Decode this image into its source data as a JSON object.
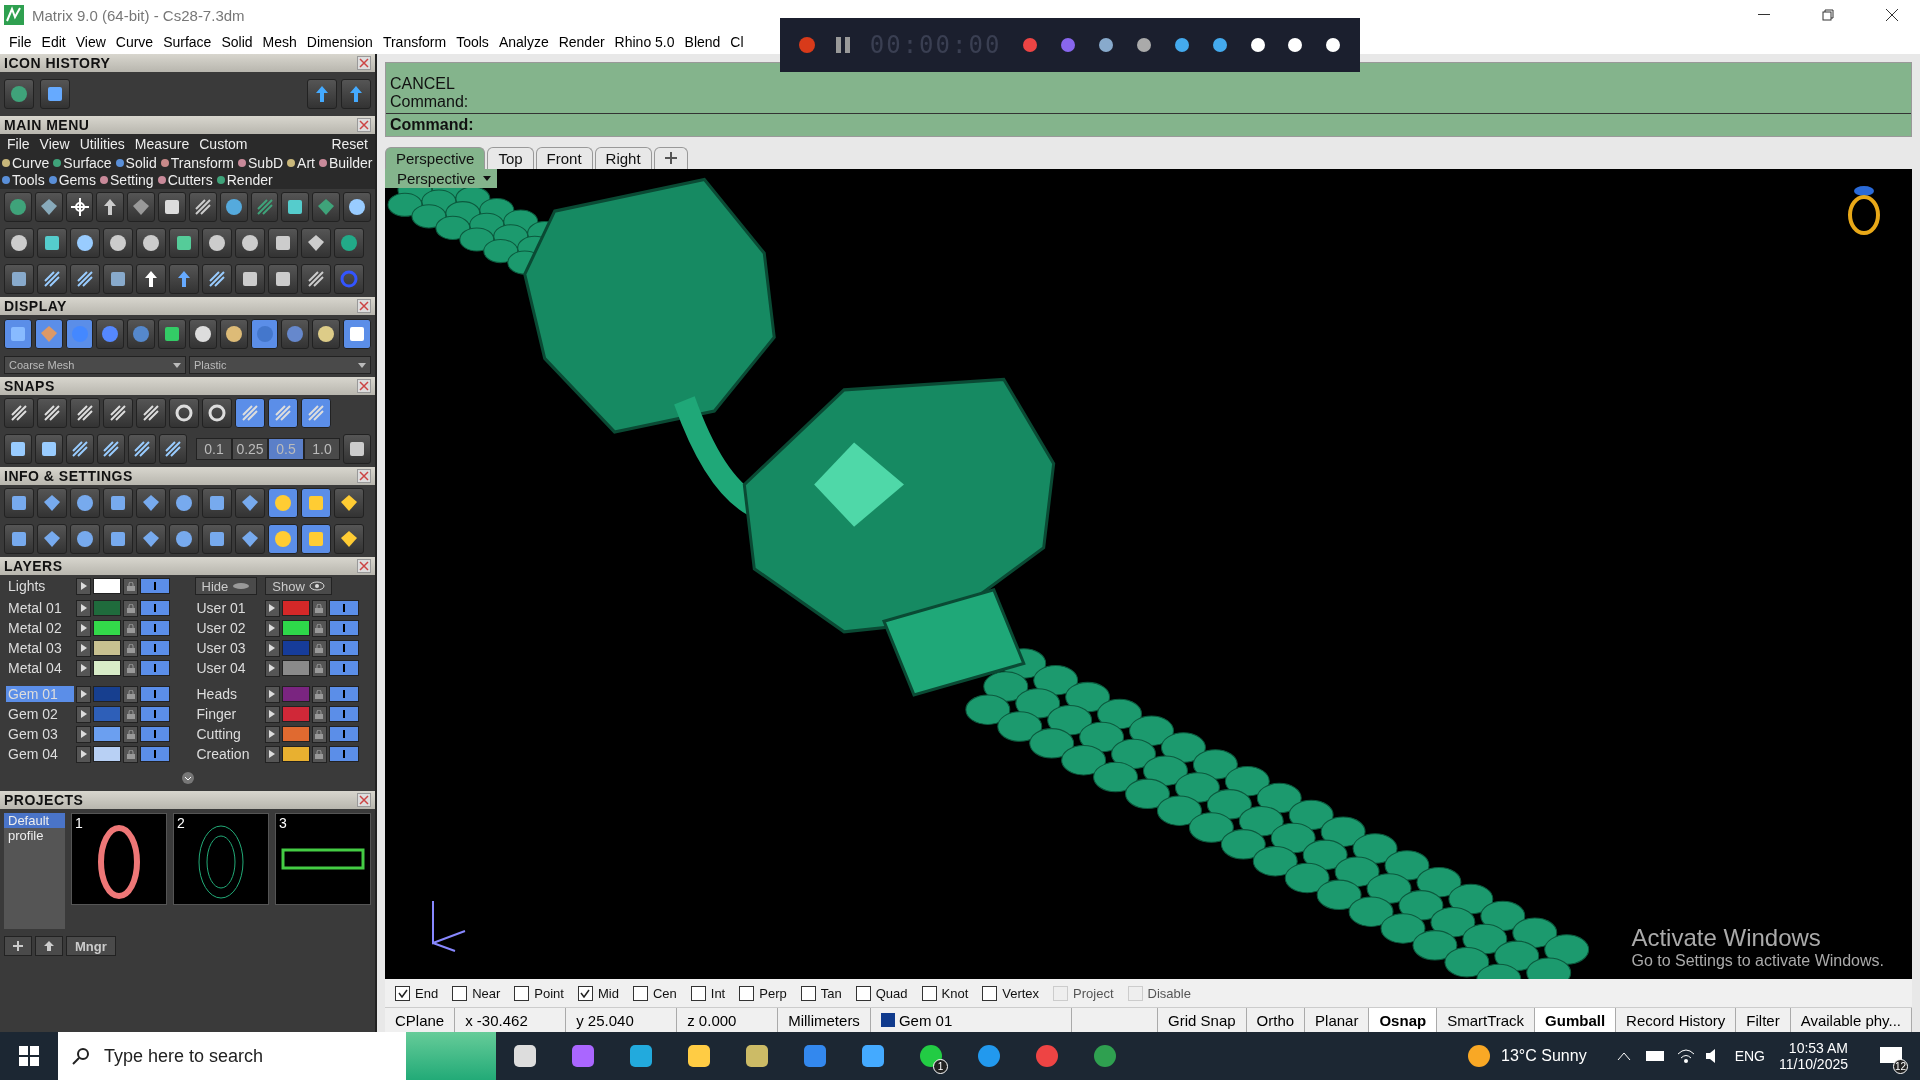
{
  "window": {
    "title": "Matrix 9.0 (64-bit) - Cs28-7.3dm"
  },
  "menu_bar": [
    "File",
    "Edit",
    "View",
    "Curve",
    "Surface",
    "Solid",
    "Mesh",
    "Dimension",
    "Transform",
    "Tools",
    "Analyze",
    "Render",
    "Rhino 5.0",
    "Blend",
    "Cl"
  ],
  "recorder": {
    "timer": "00:00:00"
  },
  "icon_history": {
    "title": "ICON HISTORY"
  },
  "main_menu": {
    "title": "MAIN MENU",
    "menu": [
      "File",
      "View",
      "Utilities",
      "Measure",
      "Custom"
    ],
    "reset": "Reset",
    "categories": [
      {
        "label": "Curve",
        "color": "#c9b77a"
      },
      {
        "label": "Surface",
        "color": "#3fa37a"
      },
      {
        "label": "Solid",
        "color": "#5a8fd8"
      },
      {
        "label": "Transform",
        "color": "#c98a8a"
      },
      {
        "label": "SubD",
        "color": "#c98a9a"
      },
      {
        "label": "Art",
        "color": "#c9b77a"
      },
      {
        "label": "Builder",
        "color": "#c98a9a"
      },
      {
        "label": "Tools",
        "color": "#5a8fd8"
      },
      {
        "label": "Gems",
        "color": "#5a8fd8"
      },
      {
        "label": "Setting",
        "color": "#c98a9a"
      },
      {
        "label": "Cutters",
        "color": "#c98a9a"
      },
      {
        "label": "Render",
        "color": "#3fa37a"
      }
    ]
  },
  "display": {
    "title": "DISPLAY",
    "mesh": "Coarse Mesh",
    "material": "Plastic"
  },
  "snaps": {
    "title": "SNAPS",
    "steps": [
      {
        "label": "0.1",
        "selected": false
      },
      {
        "label": "0.25",
        "selected": false
      },
      {
        "label": "0.5",
        "selected": true
      },
      {
        "label": "1.0",
        "selected": false
      }
    ]
  },
  "info": {
    "title": "INFO & SETTINGS"
  },
  "layers": {
    "title": "LAYERS",
    "lights": {
      "name": "Lights",
      "color": "#ffffff",
      "visible": true
    },
    "hide": "Hide",
    "show": "Show",
    "left": [
      {
        "name": "Metal 01",
        "color": "#1f6b3c",
        "selected": false,
        "visible": true
      },
      {
        "name": "Metal 02",
        "color": "#33d94a",
        "selected": false,
        "visible": true
      },
      {
        "name": "Metal 03",
        "color": "#c8c090",
        "selected": false,
        "visible": true
      },
      {
        "name": "Metal 04",
        "color": "#d8ecc8",
        "selected": false,
        "visible": true
      },
      {
        "name": "Gem 01",
        "color": "#173f8f",
        "selected": true,
        "visible": true
      },
      {
        "name": "Gem 02",
        "color": "#2e5fb8",
        "selected": false,
        "visible": true
      },
      {
        "name": "Gem 03",
        "color": "#6b9ff0",
        "selected": false,
        "visible": true
      },
      {
        "name": "Gem 04",
        "color": "#b8d0f4",
        "selected": false,
        "visible": true
      }
    ],
    "right": [
      {
        "name": "User 01",
        "color": "#d42828",
        "selected": false,
        "visible": true
      },
      {
        "name": "User 02",
        "color": "#2ed84a",
        "selected": false,
        "visible": true
      },
      {
        "name": "User 03",
        "color": "#163c9a",
        "selected": false,
        "visible": true
      },
      {
        "name": "User 04",
        "color": "#8a8a8a",
        "selected": false,
        "visible": true
      },
      {
        "name": "Heads",
        "color": "#7a2580",
        "selected": false,
        "visible": true
      },
      {
        "name": "Finger",
        "color": "#d02838",
        "selected": false,
        "visible": true
      },
      {
        "name": "Cutting",
        "color": "#e06a30",
        "selected": false,
        "visible": true
      },
      {
        "name": "Creation",
        "color": "#e8b030",
        "selected": false,
        "visible": true
      }
    ]
  },
  "projects": {
    "title": "PROJECTS",
    "profiles": [
      {
        "label": "Default",
        "selected": true
      },
      {
        "label": "profile",
        "selected": false
      }
    ],
    "thumbnails": [
      "1",
      "2",
      "3"
    ],
    "manager": "Mngr"
  },
  "command": {
    "history": [
      "CANCEL",
      "Command:"
    ],
    "prompt": "Command:"
  },
  "viewport_tabs": [
    {
      "label": "Perspective",
      "selected": true
    },
    {
      "label": "Top",
      "selected": false
    },
    {
      "label": "Front",
      "selected": false
    },
    {
      "label": "Right",
      "selected": false
    }
  ],
  "viewport": {
    "label": "Perspective"
  },
  "activation_notice": {
    "title": "Activate Windows",
    "text": "Go to Settings to activate Windows."
  },
  "osnaps": [
    {
      "label": "End",
      "checked": true,
      "disabled": false
    },
    {
      "label": "Near",
      "checked": false,
      "disabled": false
    },
    {
      "label": "Point",
      "checked": false,
      "disabled": false
    },
    {
      "label": "Mid",
      "checked": true,
      "disabled": false
    },
    {
      "label": "Cen",
      "checked": false,
      "disabled": false
    },
    {
      "label": "Int",
      "checked": false,
      "disabled": false
    },
    {
      "label": "Perp",
      "checked": false,
      "disabled": false
    },
    {
      "label": "Tan",
      "checked": false,
      "disabled": false
    },
    {
      "label": "Quad",
      "checked": false,
      "disabled": false
    },
    {
      "label": "Knot",
      "checked": false,
      "disabled": false
    },
    {
      "label": "Vertex",
      "checked": false,
      "disabled": false
    },
    {
      "label": "Project",
      "checked": false,
      "disabled": true
    },
    {
      "label": "Disable",
      "checked": false,
      "disabled": true
    }
  ],
  "status_bar": {
    "cplane": "CPlane",
    "x": "x -30.462",
    "y": "y 25.040",
    "z": "z 0.000",
    "units": "Millimeters",
    "layer": {
      "label": "Gem 01",
      "color": "#0f3a8c"
    },
    "toggles": [
      {
        "label": "Grid Snap",
        "on": false
      },
      {
        "label": "Ortho",
        "on": false
      },
      {
        "label": "Planar",
        "on": false
      },
      {
        "label": "Osnap",
        "on": true
      },
      {
        "label": "SmartTrack",
        "on": false
      },
      {
        "label": "Gumball",
        "on": true
      },
      {
        "label": "Record History",
        "on": false
      },
      {
        "label": "Filter",
        "on": false
      }
    ],
    "memory": "Available phy..."
  },
  "taskbar": {
    "search_placeholder": "Type here to search",
    "whatsapp_badge": "1",
    "weather": "13°C Sunny",
    "language": "ENG",
    "time": "10:53 AM",
    "date": "11/10/2025",
    "notifications": "12"
  }
}
